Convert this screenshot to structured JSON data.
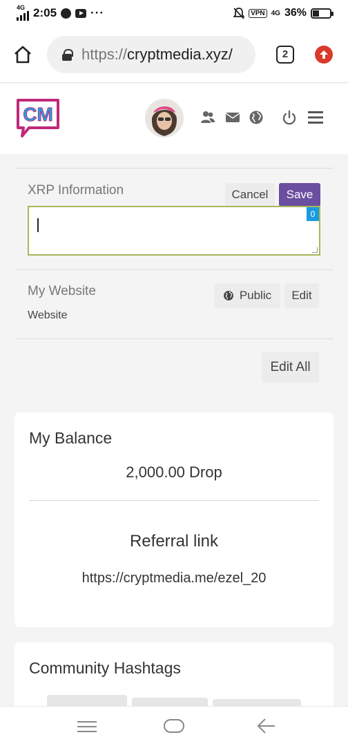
{
  "status_bar": {
    "network": "4G",
    "time": "2:05",
    "more": "···",
    "vpn": "VPN",
    "network_right": "4G",
    "battery": "36%"
  },
  "browser": {
    "url_scheme": "https://",
    "url_host": "cryptmedia.xyz/",
    "tab_count": "2"
  },
  "header": {
    "logo_text": "CM",
    "icons": [
      "users-icon",
      "mail-icon",
      "globe-icon",
      "power-icon",
      "menu-icon"
    ]
  },
  "xrp": {
    "label": "XRP Information",
    "cancel_label": "Cancel",
    "save_label": "Save",
    "input_value": "",
    "counter": "0"
  },
  "website": {
    "label": "My Website",
    "value": "Website",
    "public_label": "Public",
    "edit_label": "Edit"
  },
  "edit_all_label": "Edit All",
  "balance": {
    "title": "My Balance",
    "amount": "2,000.00 Drop",
    "referral_title": "Referral link",
    "referral_url": "https://cryptmedia.me/ezel_20"
  },
  "hashtags": {
    "title": "Community Hashtags"
  },
  "colors": {
    "accent": "#6a4ea0",
    "logo_border": "#c0287a",
    "logo_fill": "#1aa7e8",
    "counter": "#1a9be0",
    "input_border": "#a9b65a"
  }
}
